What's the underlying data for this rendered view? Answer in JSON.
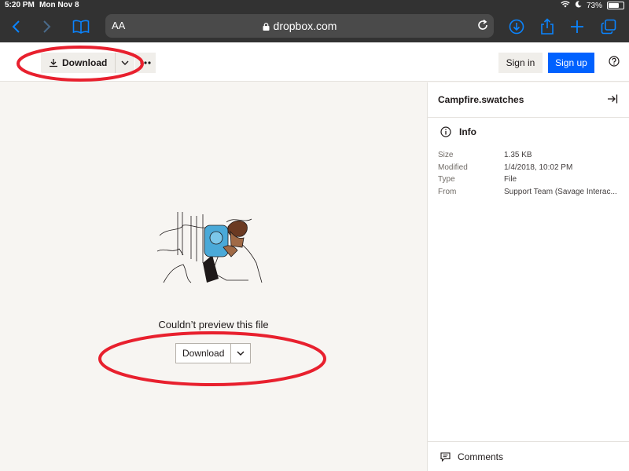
{
  "status_bar": {
    "time": "5:20 PM",
    "date": "Mon Nov 8",
    "battery": "73%",
    "battery_level": 0.73
  },
  "browser": {
    "text_size_label": "AA",
    "url": "dropbox.com"
  },
  "header": {
    "download_label": "Download",
    "sign_in_label": "Sign in",
    "sign_up_label": "Sign up"
  },
  "preview": {
    "message": "Couldn’t preview this file",
    "download_label": "Download"
  },
  "sidebar": {
    "file_name": "Campfire.swatches",
    "info_label": "Info",
    "fields": [
      {
        "key": "Size",
        "value": "1.35 KB"
      },
      {
        "key": "Modified",
        "value": "1/4/2018, 10:02 PM"
      },
      {
        "key": "Type",
        "value": "File"
      },
      {
        "key": "From",
        "value": "Support Team (Savage Interac..."
      }
    ],
    "comments_label": "Comments"
  },
  "colors": {
    "accent": "#0061fe",
    "annotation": "#e8202e",
    "chrome": "#323232",
    "ios_blue": "#0a84ff"
  }
}
